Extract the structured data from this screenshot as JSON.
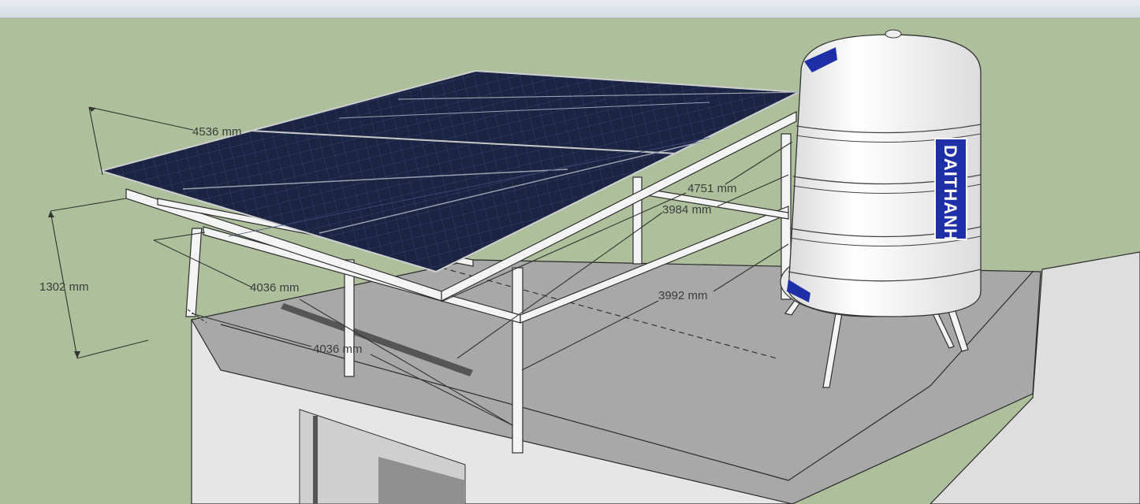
{
  "toolbar": {
    "visible": true
  },
  "scene": {
    "background_color": "#adbf9b",
    "roof_color": "#a6a6a6",
    "panel_color": "#1b2340",
    "frame_color": "#f4f4f4",
    "tank_color": "#f2f2f2",
    "label_color": "#1f2fa8"
  },
  "tank": {
    "brand": "DAITHANH"
  },
  "dimensions": {
    "width_top": "4536 mm",
    "height_left": "1302 mm",
    "depth_front": "4036 mm",
    "depth_base": "4036 mm",
    "diag_long": "4751 mm",
    "diag_mid": "3984 mm",
    "diag_base": "3992 mm"
  }
}
